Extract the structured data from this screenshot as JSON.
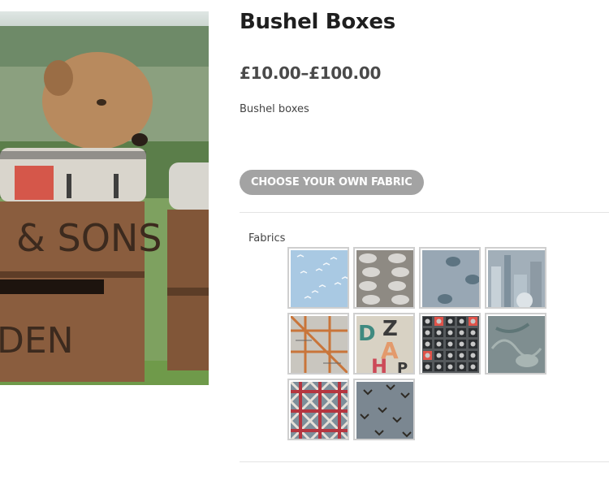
{
  "product": {
    "title": "Bushel Boxes",
    "price_range": "£10.00–£100.00",
    "short_description": "Bushel boxes",
    "image_alt": "Terrier dog behind vintage wooden bushel boxes with fabric cushion tops",
    "image_crate_text_1": "& SONS",
    "image_crate_text_2": "DEN"
  },
  "actions": {
    "choose_fabric_label": "CHOOSE YOUR OWN FABRIC",
    "button_color": "#a3a3a3"
  },
  "fabrics": {
    "label": "Fabrics",
    "swatches": [
      {
        "name": "seagulls",
        "bg": "#a9c9e3"
      },
      {
        "name": "sheep",
        "bg": "#8e8a83"
      },
      {
        "name": "pigs",
        "bg": "#98a7b4"
      },
      {
        "name": "city-skyline",
        "bg": "#a2afb9"
      },
      {
        "name": "tube-map",
        "bg": "#c9c6bf"
      },
      {
        "name": "alphabet",
        "bg": "#d8d2c4"
      },
      {
        "name": "postage-stamps",
        "bg": "#55595c"
      },
      {
        "name": "toile-birds",
        "bg": "#7f8e90"
      },
      {
        "name": "union-jack",
        "bg": "#7d8e9a"
      },
      {
        "name": "swallows",
        "bg": "#7b8791"
      }
    ]
  }
}
